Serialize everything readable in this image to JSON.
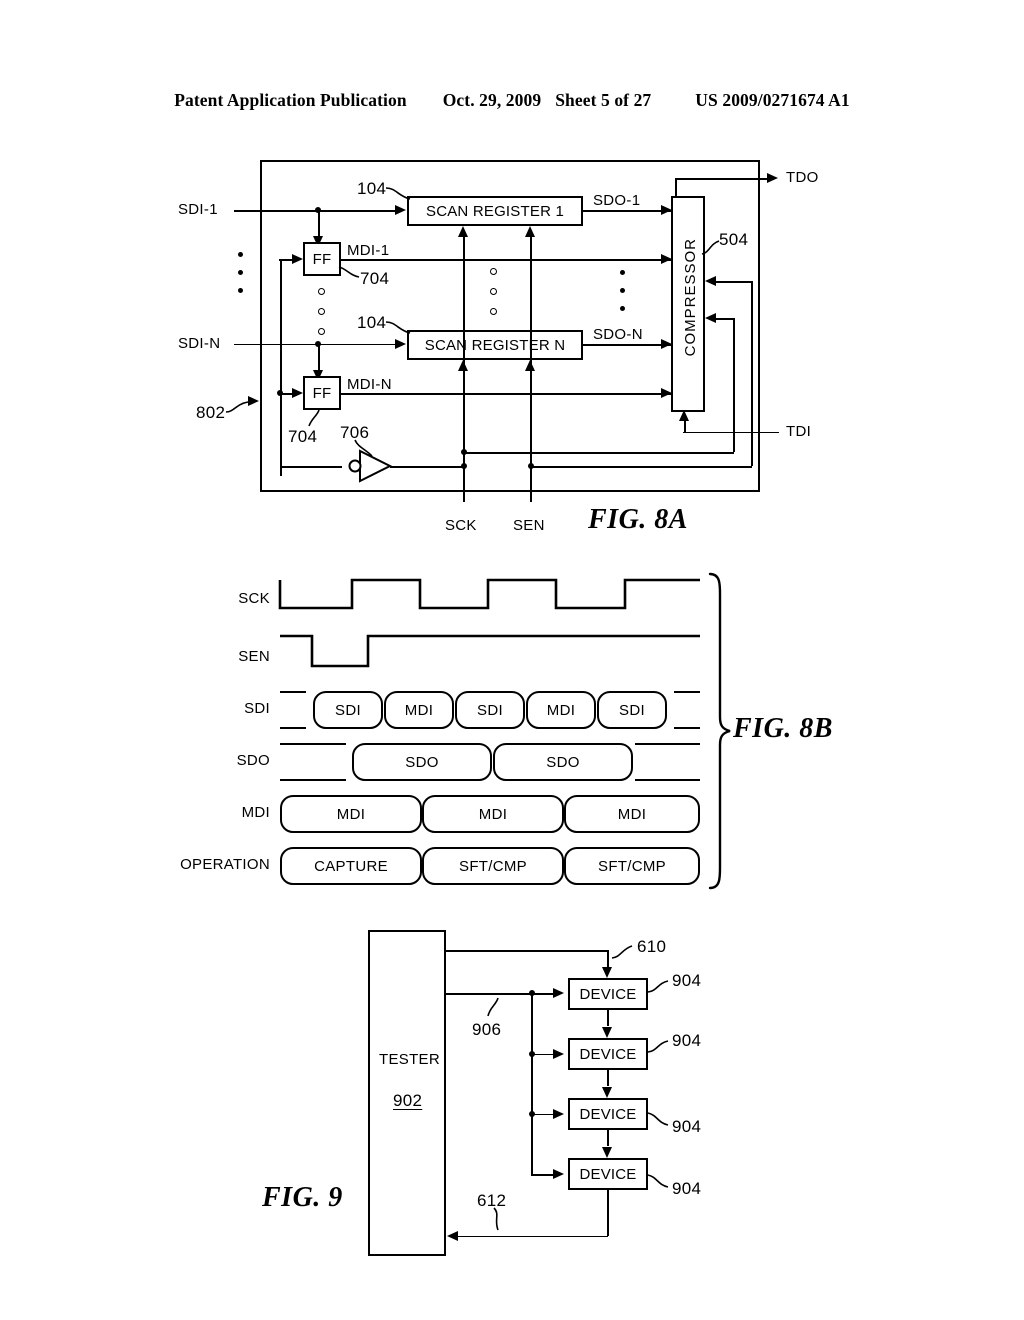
{
  "header": {
    "publication": "Patent Application Publication",
    "date": "Oct. 29, 2009",
    "sheet": "Sheet 5 of 27",
    "number": "US 2009/0271674 A1"
  },
  "fig8a": {
    "label": "FIG. 8A",
    "inputs": {
      "sdi_1": "SDI-1",
      "sdi_n": "SDI-N"
    },
    "outputs": {
      "tdo": "TDO",
      "tdi": "TDI"
    },
    "clock_labels": {
      "sck": "SCK",
      "sen": "SEN"
    },
    "blocks": {
      "scan_register_1": "SCAN REGISTER 1",
      "scan_register_n": "SCAN REGISTER N",
      "compressor": "COMPRESSOR",
      "ff_1": "FF",
      "ff_n": "FF"
    },
    "signals": {
      "mdi_1": "MDI-1",
      "mdi_n": "MDI-N",
      "sdo_1": "SDO-1",
      "sdo_n": "SDO-N"
    },
    "refs": {
      "scan_reg_1": "104",
      "scan_reg_n": "104",
      "ff_1": "704",
      "ff_n": "704",
      "inverter": "706",
      "compressor": "504",
      "system": "802"
    }
  },
  "fig8b": {
    "label": "FIG. 8B",
    "rows": [
      {
        "name": "SCK",
        "type": "clock"
      },
      {
        "name": "SEN",
        "type": "clock"
      },
      {
        "name": "SDI",
        "type": "bus",
        "cells": [
          "SDI",
          "MDI",
          "SDI",
          "MDI",
          "SDI"
        ]
      },
      {
        "name": "SDO",
        "type": "bus",
        "cells": [
          "SDO",
          "SDO"
        ]
      },
      {
        "name": "MDI",
        "type": "bus",
        "cells": [
          "MDI",
          "MDI",
          "MDI"
        ]
      },
      {
        "name": "OPERATION",
        "type": "bus",
        "cells": [
          "CAPTURE",
          "SFT/CMP",
          "SFT/CMP"
        ]
      }
    ]
  },
  "fig9": {
    "label": "FIG. 9",
    "tester": {
      "name": "TESTER",
      "ref": "902"
    },
    "devices": [
      {
        "name": "DEVICE",
        "ref": "904"
      },
      {
        "name": "DEVICE",
        "ref": "904"
      },
      {
        "name": "DEVICE",
        "ref": "904"
      },
      {
        "name": "DEVICE",
        "ref": "904"
      }
    ],
    "refs": {
      "top_bus": "610",
      "mid_bus": "906",
      "return_bus": "612"
    }
  }
}
